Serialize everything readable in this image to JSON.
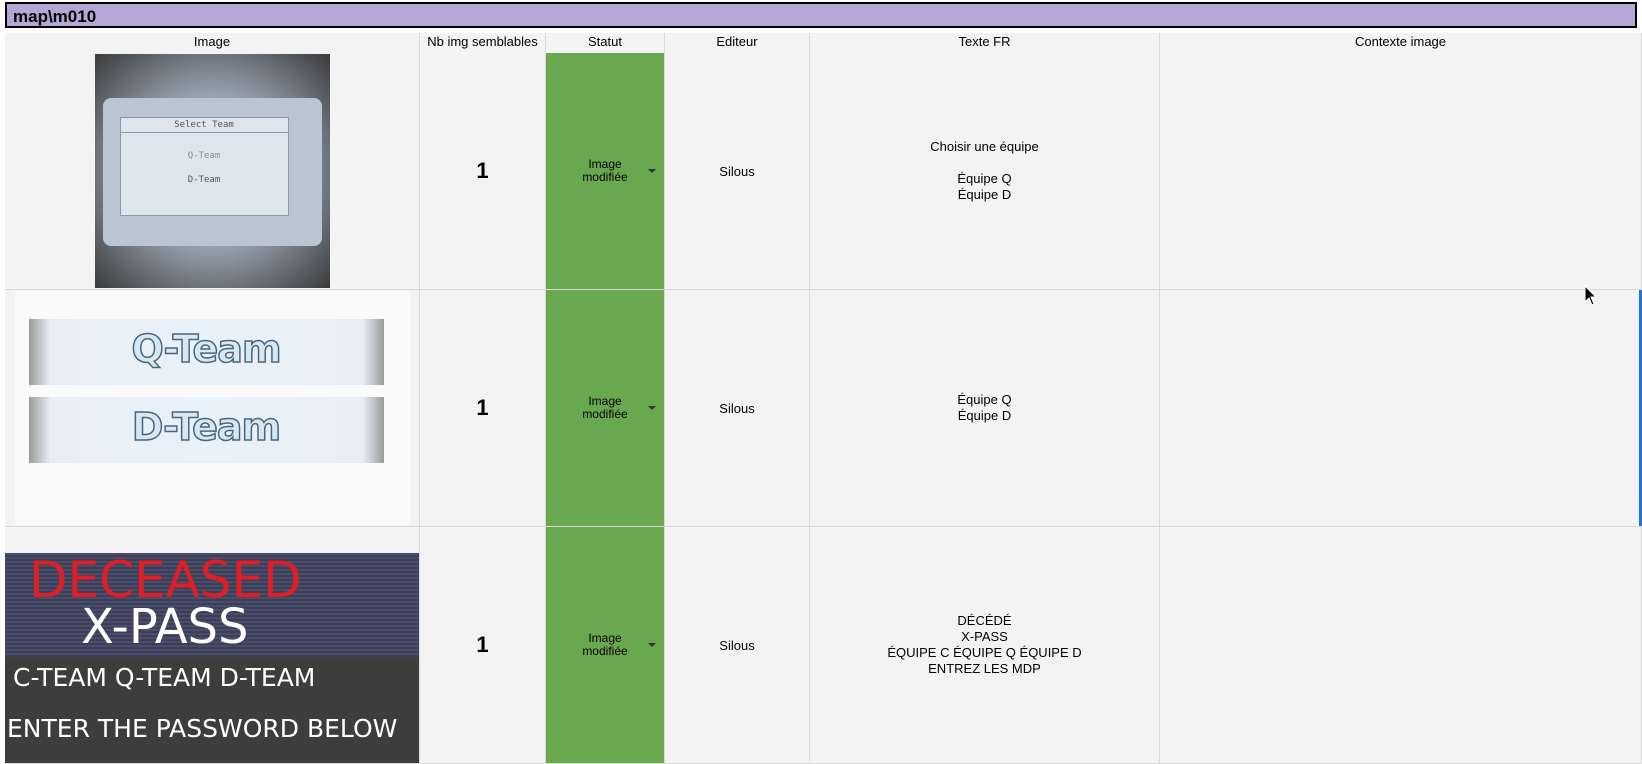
{
  "sheet": {
    "title": "map\\m010"
  },
  "columns": [
    "Image",
    "Nb img semblables",
    "Statut",
    "Editeur",
    "Texte FR",
    "Contexte image"
  ],
  "colors": {
    "title_bar": "#b4a7d6",
    "status_ok": "#6aa84f",
    "cell_bg": "#f3f3f3",
    "selection": "#1a73e8"
  },
  "rows": [
    {
      "image": {
        "title": "Select Team",
        "opt1": "Q-Team",
        "opt2": "D-Team"
      },
      "nb": "1",
      "status": "Image\nmodifiée",
      "editor": "Silous",
      "texte_fr": "Choisir une équipe\n\nÉquipe Q\nÉquipe D",
      "contexte": ""
    },
    {
      "image": {
        "band1": "Q-Team",
        "band2": "D-Team"
      },
      "nb": "1",
      "status": "Image\nmodifiée",
      "editor": "Silous",
      "texte_fr": "Équipe Q\nÉquipe D",
      "contexte": ""
    },
    {
      "image": {
        "line1": "DECEASED",
        "line2": "X-PASS",
        "line3": "C-TEAM Q-TEAM D-TEAM",
        "line4": "ENTER THE PASSWORD BELOW"
      },
      "nb": "1",
      "status": "Image\nmodifiée",
      "editor": "Silous",
      "texte_fr": "DÉCÉDÉ\nX-PASS\nÉQUIPE C ÉQUIPE Q ÉQUIPE D\nENTREZ LES MDP",
      "contexte": ""
    }
  ]
}
